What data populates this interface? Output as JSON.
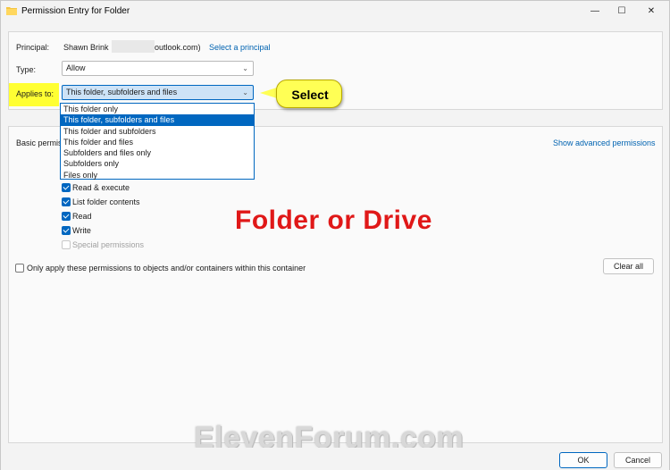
{
  "window": {
    "title": "Permission Entry for Folder",
    "minimize_glyph": "—",
    "maximize_glyph": "☐",
    "close_glyph": "✕"
  },
  "principal": {
    "label": "Principal:",
    "name": "Shawn Brink",
    "email_suffix": "outlook.com)",
    "select_link": "Select a principal"
  },
  "type": {
    "label": "Type:",
    "value": "Allow"
  },
  "applies_to": {
    "label": "Applies to:",
    "value": "This folder, subfolders and files",
    "options": [
      "This folder only",
      "This folder, subfolders and files",
      "This folder and subfolders",
      "This folder and files",
      "Subfolders and files only",
      "Subfolders only",
      "Files only"
    ],
    "selected_index": 1
  },
  "callout": {
    "text": "Select"
  },
  "basic_permissions": {
    "label": "Basic permis",
    "show_advanced_link": "Show advanced permissions",
    "items": [
      {
        "label": "Read & execute",
        "checked": true,
        "disabled": false
      },
      {
        "label": "List folder contents",
        "checked": true,
        "disabled": false
      },
      {
        "label": "Read",
        "checked": true,
        "disabled": false
      },
      {
        "label": "Write",
        "checked": true,
        "disabled": false
      },
      {
        "label": "Special permissions",
        "checked": false,
        "disabled": true
      }
    ]
  },
  "only_apply": {
    "label": "Only apply these permissions to objects and/or containers within this container",
    "checked": false
  },
  "clear_all": "Clear all",
  "annotation": "Folder or Drive",
  "watermark": "ElevenForum.com",
  "footer": {
    "ok": "OK",
    "cancel": "Cancel"
  },
  "colors": {
    "accent": "#0067c0",
    "link": "#0063b1",
    "annotation_red": "#e01818",
    "highlight_yellow": "#ffff33"
  }
}
